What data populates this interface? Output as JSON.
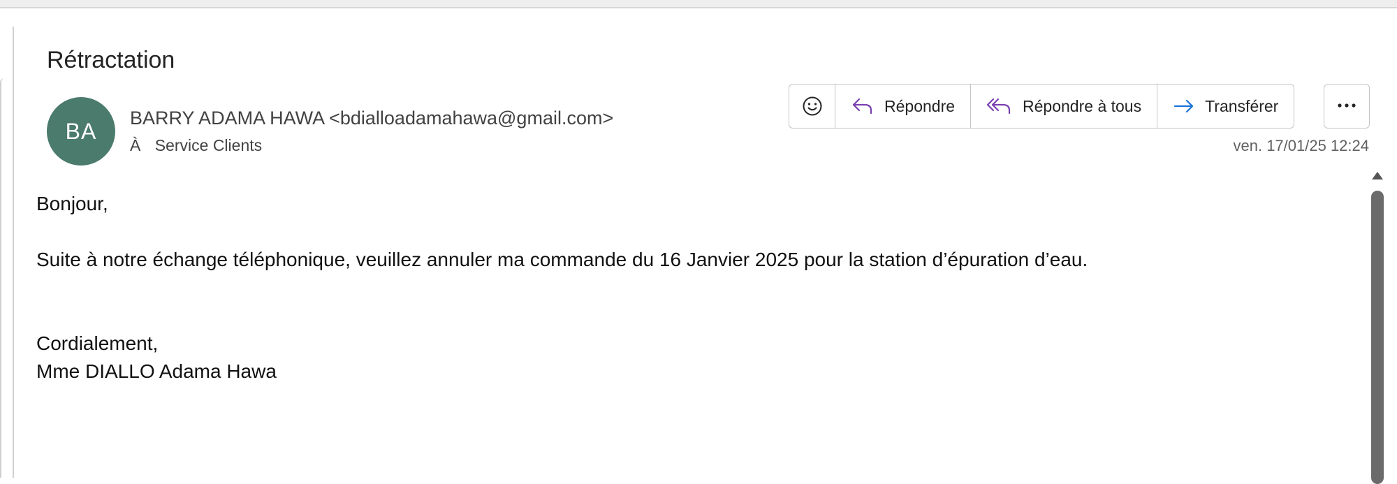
{
  "email": {
    "subject": "Rétractation",
    "avatar_initials": "BA",
    "avatar_color": "#4b7b6d",
    "sender": "BARRY ADAMA HAWA <bdialloadamahawa@gmail.com>",
    "to_label": "À",
    "recipient": "Service Clients",
    "timestamp": "ven. 17/01/25 12:24"
  },
  "actions": {
    "emoji_icon": "smiley-icon",
    "reply": {
      "label": "Répondre",
      "icon": "reply-icon"
    },
    "reply_all": {
      "label": "Répondre à tous",
      "icon": "reply-all-icon"
    },
    "forward": {
      "label": "Transférer",
      "icon": "forward-icon"
    },
    "more_icon": "more-horizontal-icon",
    "accent_color": "#7a3fb0",
    "forward_color": "#1a73d9"
  },
  "body": {
    "greeting": "Bonjour,",
    "text": "Suite à notre échange téléphonique, veuillez annuler ma commande du 16 Janvier 2025 pour la station d’épuration d’eau.",
    "closing": "Cordialement,",
    "signature": "Mme DIALLO Adama Hawa"
  }
}
